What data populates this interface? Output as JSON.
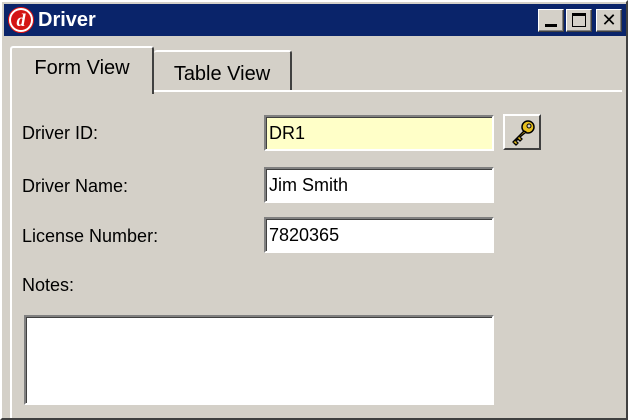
{
  "window": {
    "title": "Driver",
    "app_icon_letter": "d",
    "controls": {
      "minimize": "minimize",
      "maximize": "maximize",
      "close": "✕"
    }
  },
  "tabs": [
    {
      "label": "Form View",
      "active": true
    },
    {
      "label": "Table View",
      "active": false
    }
  ],
  "form": {
    "driver_id": {
      "label": "Driver ID:",
      "value": "DR1",
      "highlight_color": "#ffffc8"
    },
    "driver_name": {
      "label": "Driver Name:",
      "value": "Jim Smith"
    },
    "license_number": {
      "label": "License Number:",
      "value": "7820365"
    },
    "notes": {
      "label": "Notes:",
      "value": ""
    }
  },
  "icons": {
    "lookup": "key-icon"
  },
  "colors": {
    "titlebar": "#0a246a",
    "window_bg": "#d4d0c8",
    "app_icon": "#d41414"
  }
}
